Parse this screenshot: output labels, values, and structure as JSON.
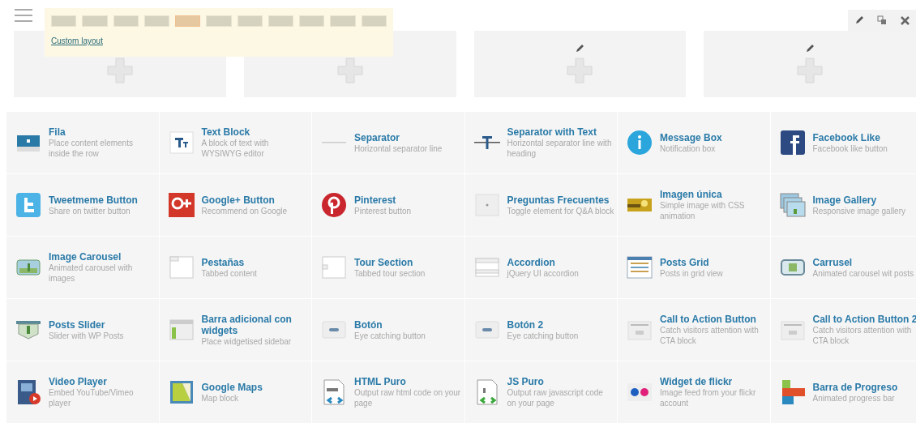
{
  "layout_popup": {
    "layouts": [
      {
        "selected": false
      },
      {
        "selected": false
      },
      {
        "selected": false
      },
      {
        "selected": false
      },
      {
        "selected": true
      },
      {
        "selected": false
      },
      {
        "selected": false
      },
      {
        "selected": false
      },
      {
        "selected": false
      },
      {
        "selected": false
      },
      {
        "selected": false
      }
    ],
    "custom_link": "Custom layout"
  },
  "elements": [
    {
      "title": "Fila",
      "description": "Place content elements inside the row"
    },
    {
      "title": "Text Block",
      "description": "A block of text with WYSIWYG editor"
    },
    {
      "title": "Separator",
      "description": "Horizontal separator line"
    },
    {
      "title": "Separator with Text",
      "description": "Horizontal separator line with heading"
    },
    {
      "title": "Message Box",
      "description": "Notification box"
    },
    {
      "title": "Facebook Like",
      "description": "Facebook like button"
    },
    {
      "title": "Tweetmeme Button",
      "description": "Share on twitter button"
    },
    {
      "title": "Google+ Button",
      "description": "Recommend on Google"
    },
    {
      "title": "Pinterest",
      "description": "Pinterest button"
    },
    {
      "title": "Preguntas Frecuentes",
      "description": "Toggle element for Q&A block"
    },
    {
      "title": "Imagen única",
      "description": "Simple image with CSS animation"
    },
    {
      "title": "Image Gallery",
      "description": "Responsive image gallery"
    },
    {
      "title": "Image Carousel",
      "description": "Animated carousel with images"
    },
    {
      "title": "Pestañas",
      "description": "Tabbed content"
    },
    {
      "title": "Tour Section",
      "description": "Tabbed tour section"
    },
    {
      "title": "Accordion",
      "description": "jQuery UI accordion"
    },
    {
      "title": "Posts Grid",
      "description": "Posts in grid view"
    },
    {
      "title": "Carrusel",
      "description": "Animated carousel wit posts"
    },
    {
      "title": "Posts Slider",
      "description": "Slider with WP Posts"
    },
    {
      "title": "Barra adicional con widgets",
      "description": "Place widgetised sidebar"
    },
    {
      "title": "Botón",
      "description": "Eye catching button"
    },
    {
      "title": "Botón 2",
      "description": "Eye catching button"
    },
    {
      "title": "Call to Action Button",
      "description": "Catch visitors attention with CTA block"
    },
    {
      "title": "Call to Action Button 2",
      "description": "Catch visitors attention with CTA block"
    },
    {
      "title": "Video Player",
      "description": "Embed YouTube/Vimeo player"
    },
    {
      "title": "Google Maps",
      "description": "Map block"
    },
    {
      "title": "HTML Puro",
      "description": "Output raw html code on your page"
    },
    {
      "title": "JS Puro",
      "description": "Output raw javascript code on your page"
    },
    {
      "title": "Widget de flickr",
      "description": "Image feed from your flickr account"
    },
    {
      "title": "Barra de Progreso",
      "description": "Animated progress bar"
    }
  ]
}
